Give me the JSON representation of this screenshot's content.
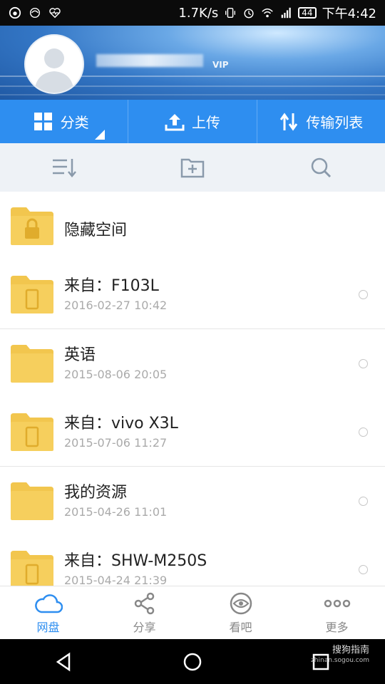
{
  "status_bar": {
    "speed": "1.7K/s",
    "battery": "44",
    "time": "下午4:42"
  },
  "header": {
    "vip_label": "VIP"
  },
  "action_bar": {
    "category_label": "分类",
    "upload_label": "上传",
    "transfer_label": "传输列表"
  },
  "files": [
    {
      "name": "隐藏空间",
      "date": "",
      "type": "locked"
    },
    {
      "name": "来自：F103L",
      "date": "2016-02-27  10:42",
      "type": "device"
    },
    {
      "name": "英语",
      "date": "2015-08-06  20:05",
      "type": "plain"
    },
    {
      "name": "来自：vivo X3L",
      "date": "2015-07-06  11:27",
      "type": "device"
    },
    {
      "name": "我的资源",
      "date": "2015-04-26  11:01",
      "type": "plain"
    },
    {
      "name": "来自：SHW-M250S",
      "date": "2015-04-24  21:39",
      "type": "device"
    }
  ],
  "bottom_nav": {
    "items": [
      {
        "label": "网盘",
        "icon": "cloud-icon",
        "active": true
      },
      {
        "label": "分享",
        "icon": "share-icon",
        "active": false
      },
      {
        "label": "看吧",
        "icon": "eye-icon",
        "active": false
      },
      {
        "label": "更多",
        "icon": "more-icon",
        "active": false
      }
    ]
  },
  "watermark": {
    "line1": "搜狗指南",
    "line2": "zhinan.sogou.com"
  },
  "colors": {
    "accent": "#2e8ef0",
    "folder": "#f2c64e"
  }
}
